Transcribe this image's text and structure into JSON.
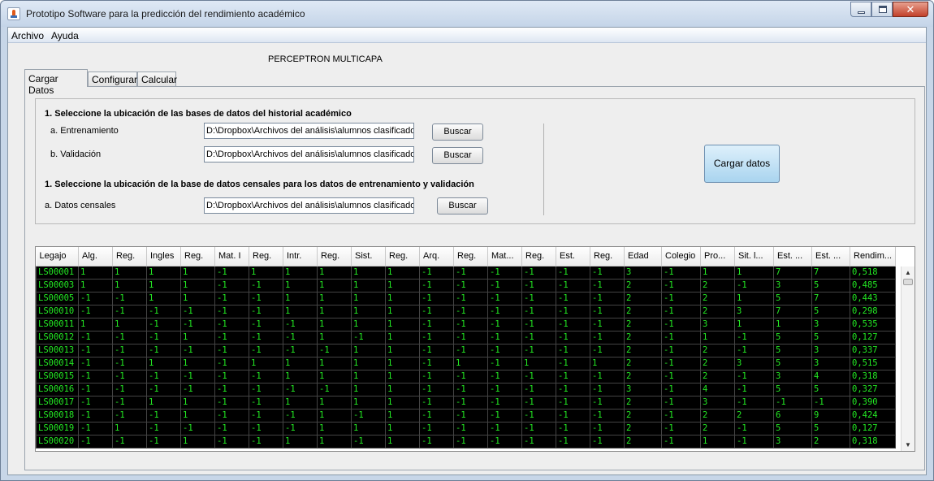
{
  "window": {
    "title": "Prototipo Software para la predicción del rendimiento académico",
    "close_glyph": "✕"
  },
  "menu": [
    "Archivo",
    "Ayuda"
  ],
  "panel_title": "PERCEPTRON MULTICAPA",
  "tabs": [
    "Cargar Datos",
    "Configurar",
    "Calcular"
  ],
  "section1": {
    "heading": "1. Seleccione la ubicación de las bases de datos del historial académico",
    "training_label": "a. Entrenamiento",
    "training_path": "D:\\Dropbox\\Archivos del análisis\\alumnos clasificados",
    "validation_label": "b. Validación",
    "validation_path": "D:\\Dropbox\\Archivos del análisis\\alumnos clasificados",
    "browse": "Buscar"
  },
  "section2": {
    "heading": "1. Seleccione la ubicación de la base de datos censales para los datos de entrenamiento y validación",
    "census_label": "a. Datos censales",
    "census_path": "D:\\Dropbox\\Archivos del análisis\\alumnos clasificados",
    "browse": "Buscar"
  },
  "load_button": "Cargar datos",
  "table": {
    "columns": [
      "Legajo",
      "Alg.",
      "Reg.",
      "Ingles",
      "Reg.",
      "Mat. I",
      "Reg.",
      "Intr.",
      "Reg.",
      "Sist.",
      "Reg.",
      "Arq.",
      "Reg.",
      "Mat...",
      "Reg.",
      "Est.",
      "Reg.",
      "Edad",
      "Colegio",
      "Pro...",
      "Sit. l...",
      "Est. ...",
      "Est. ...",
      "Rendim..."
    ],
    "rows": [
      [
        "LS00001",
        "1",
        "1",
        "1",
        "1",
        "-1",
        "1",
        "1",
        "1",
        "1",
        "1",
        "-1",
        "-1",
        "-1",
        "-1",
        "-1",
        "-1",
        "3",
        "-1",
        "1",
        "1",
        "7",
        "7",
        "0,518"
      ],
      [
        "LS00003",
        "1",
        "1",
        "1",
        "1",
        "-1",
        "-1",
        "1",
        "1",
        "1",
        "1",
        "-1",
        "-1",
        "-1",
        "-1",
        "-1",
        "-1",
        "2",
        "-1",
        "2",
        "-1",
        "3",
        "5",
        "0,485"
      ],
      [
        "LS00005",
        "-1",
        "-1",
        "1",
        "1",
        "-1",
        "-1",
        "1",
        "1",
        "1",
        "1",
        "-1",
        "-1",
        "-1",
        "-1",
        "-1",
        "-1",
        "2",
        "-1",
        "2",
        "1",
        "5",
        "7",
        "0,443"
      ],
      [
        "LS00010",
        "-1",
        "-1",
        "-1",
        "-1",
        "-1",
        "-1",
        "1",
        "1",
        "1",
        "1",
        "-1",
        "-1",
        "-1",
        "-1",
        "-1",
        "-1",
        "2",
        "-1",
        "2",
        "3",
        "7",
        "5",
        "0,298"
      ],
      [
        "LS00011",
        "1",
        "1",
        "-1",
        "-1",
        "-1",
        "-1",
        "-1",
        "1",
        "1",
        "1",
        "-1",
        "-1",
        "-1",
        "-1",
        "-1",
        "-1",
        "2",
        "-1",
        "3",
        "1",
        "1",
        "3",
        "0,535"
      ],
      [
        "LS00012",
        "-1",
        "-1",
        "-1",
        "1",
        "-1",
        "-1",
        "-1",
        "1",
        "-1",
        "1",
        "-1",
        "-1",
        "-1",
        "-1",
        "-1",
        "-1",
        "2",
        "-1",
        "1",
        "-1",
        "5",
        "5",
        "0,127"
      ],
      [
        "LS00013",
        "-1",
        "-1",
        "-1",
        "-1",
        "-1",
        "-1",
        "-1",
        "-1",
        "1",
        "1",
        "-1",
        "-1",
        "-1",
        "-1",
        "-1",
        "-1",
        "2",
        "-1",
        "2",
        "-1",
        "5",
        "3",
        "0,337"
      ],
      [
        "LS00014",
        "-1",
        "-1",
        "1",
        "1",
        "-1",
        "1",
        "1",
        "1",
        "1",
        "1",
        "-1",
        "1",
        "-1",
        "1",
        "-1",
        "1",
        "2",
        "-1",
        "2",
        "3",
        "5",
        "3",
        "0,515"
      ],
      [
        "LS00015",
        "-1",
        "-1",
        "-1",
        "-1",
        "-1",
        "-1",
        "1",
        "1",
        "1",
        "1",
        "-1",
        "-1",
        "-1",
        "-1",
        "-1",
        "-1",
        "2",
        "-1",
        "2",
        "-1",
        "3",
        "4",
        "0,318"
      ],
      [
        "LS00016",
        "-1",
        "-1",
        "-1",
        "-1",
        "-1",
        "-1",
        "-1",
        "-1",
        "1",
        "1",
        "-1",
        "-1",
        "-1",
        "-1",
        "-1",
        "-1",
        "3",
        "-1",
        "4",
        "-1",
        "5",
        "5",
        "0,327"
      ],
      [
        "LS00017",
        "-1",
        "-1",
        "1",
        "1",
        "-1",
        "-1",
        "1",
        "1",
        "1",
        "1",
        "-1",
        "-1",
        "-1",
        "-1",
        "-1",
        "-1",
        "2",
        "-1",
        "3",
        "-1",
        "-1",
        "-1",
        "0,390"
      ],
      [
        "LS00018",
        "-1",
        "-1",
        "-1",
        "1",
        "-1",
        "-1",
        "-1",
        "1",
        "-1",
        "1",
        "-1",
        "-1",
        "-1",
        "-1",
        "-1",
        "-1",
        "2",
        "-1",
        "2",
        "2",
        "6",
        "9",
        "0,424"
      ],
      [
        "LS00019",
        "-1",
        "1",
        "-1",
        "-1",
        "-1",
        "-1",
        "-1",
        "1",
        "1",
        "1",
        "-1",
        "-1",
        "-1",
        "-1",
        "-1",
        "-1",
        "2",
        "-1",
        "2",
        "-1",
        "5",
        "5",
        "0,127"
      ],
      [
        "LS00020",
        "-1",
        "-1",
        "-1",
        "1",
        "-1",
        "-1",
        "1",
        "1",
        "-1",
        "1",
        "-1",
        "-1",
        "-1",
        "-1",
        "-1",
        "-1",
        "2",
        "-1",
        "1",
        "-1",
        "3",
        "2",
        "0,318"
      ]
    ]
  },
  "scroll_glyphs": {
    "up": "▲",
    "down": "▼"
  }
}
